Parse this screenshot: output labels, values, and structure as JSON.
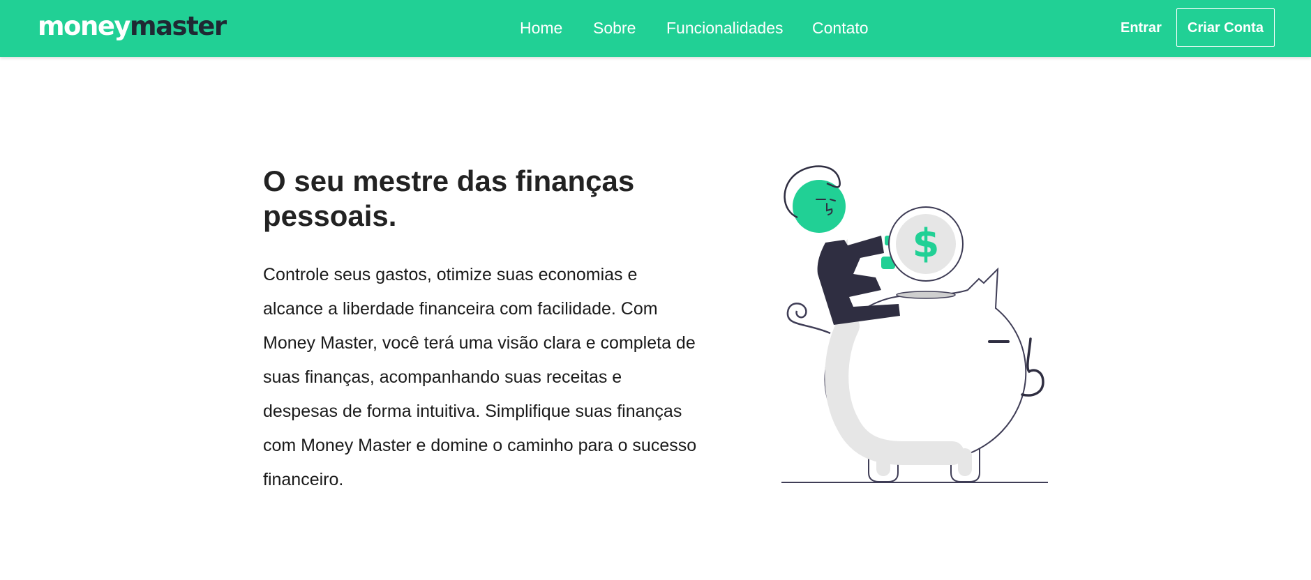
{
  "header": {
    "logo": {
      "part1": "money",
      "part2": "master"
    },
    "nav": [
      {
        "label": "Home"
      },
      {
        "label": "Sobre"
      },
      {
        "label": "Funcionalidades"
      },
      {
        "label": "Contato"
      }
    ],
    "login_label": "Entrar",
    "signup_label": "Criar Conta"
  },
  "hero": {
    "title": "O seu mestre das finanças pessoais.",
    "description": "Controle seus gastos, otimize suas economias e alcance a liberdade financeira com facilidade. Com Money Master, você terá uma visão clara e completa de suas finanças, acompanhando suas receitas e despesas de forma intuitiva. Simplifique suas finanças com Money Master e domine o caminho para o sucesso financeiro.",
    "coin_symbol": "$"
  },
  "colors": {
    "brand_green": "#21d095",
    "dark": "#2f2e41",
    "text": "#222222",
    "light_gray": "#e6e6e6"
  },
  "icons": {
    "illustration": "person-inserting-coin-into-piggy-bank"
  }
}
